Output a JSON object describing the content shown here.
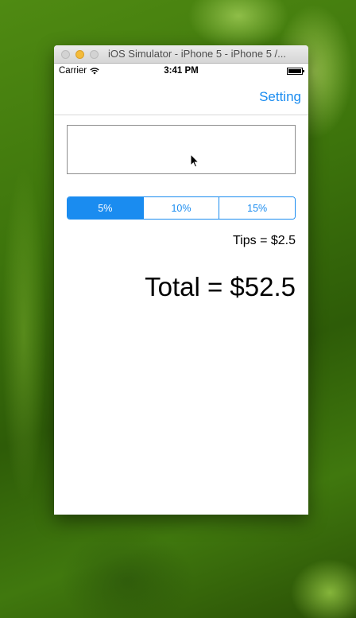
{
  "window": {
    "title": "iOS Simulator - iPhone 5 - iPhone 5 /..."
  },
  "status_bar": {
    "carrier": "Carrier",
    "time": "3:41 PM"
  },
  "nav_bar": {
    "setting_label": "Setting"
  },
  "bill_input": {
    "value": ""
  },
  "tip_selector": {
    "options": [
      "5%",
      "10%",
      "15%"
    ],
    "selected": "5%"
  },
  "tips_text": "Tips = $2.5",
  "total_text": "Total = $52.5",
  "colors": {
    "accent": "#1a8cf0",
    "minimize_light": "#f4bb3a"
  },
  "icons": [
    "wifi-icon",
    "battery-icon",
    "mouse-pointer-icon"
  ]
}
